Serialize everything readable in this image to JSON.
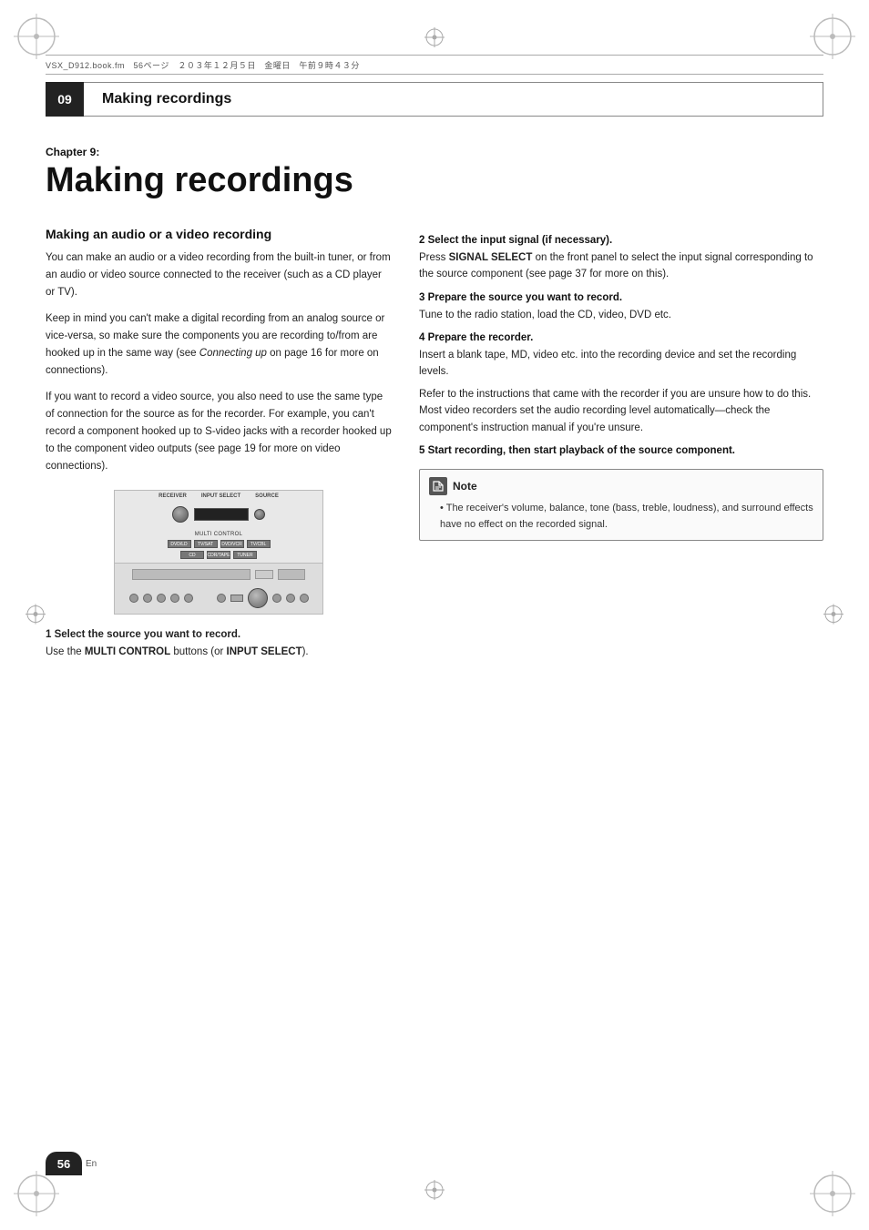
{
  "header": {
    "file_info": "VSX_D912.book.fm　56ページ　２０３年１２月５日　金曜日　午前９時４３分",
    "chapter_num": "09",
    "chapter_title": "Making recordings"
  },
  "chapter": {
    "label": "Chapter 9:",
    "title": "Making recordings"
  },
  "section": {
    "heading": "Making an audio or a video recording",
    "para1": "You can make an audio or a video recording from the built-in tuner, or from an audio or video source connected to the receiver (such as a CD player or TV).",
    "para2": "Keep in mind you can't make a digital recording from an analog source or vice-versa, so make sure the components you are recording to/from are hooked up in the same way (see Connecting up on page 16 for more on connections).",
    "para3": "If you want to record a video source, you also need to use the same type of connection for the source as for the recorder. For example, you can't record a component hooked up to S-video jacks with a recorder hooked up to the component video outputs (see page 19 for more on video connections)."
  },
  "steps": {
    "step1_heading": "1   Select the source you want to record.",
    "step1_text": "Use the MULTI CONTROL buttons (or INPUT SELECT).",
    "step2_heading": "2   Select the input signal (if necessary).",
    "step2_text": "Press SIGNAL SELECT on the front panel to select the input signal corresponding to the source component (see page 37 for more on this).",
    "step3_heading": "3   Prepare the source you want to record.",
    "step3_text": "Tune to the radio station, load the CD, video, DVD etc.",
    "step4_heading": "4   Prepare the recorder.",
    "step4_text1": "Insert a blank tape, MD, video etc. into the recording device and set the recording levels.",
    "step4_text2": "Refer to the instructions that came with the recorder if you are unsure how to do this. Most video recorders set the audio recording level automatically—check the component's instruction manual if you're unsure.",
    "step5_heading": "5   Start recording, then start playback of the source component.",
    "step2_signal_select": "SIGNAL SELECT",
    "step1_multi_control": "MULTI CONTROL",
    "step1_input_select": "INPUT SELECT"
  },
  "note": {
    "label": "Note",
    "bullet1": "The receiver's volume, balance, tone (bass, treble, loudness), and surround effects have no effect on the recorded signal."
  },
  "footer": {
    "page_num": "56",
    "lang": "En"
  },
  "device_buttons": {
    "btn1": "DVD/LD",
    "btn2": "TV/SAT",
    "btn3": "DVD/VCR",
    "btn4": "TV/CBL",
    "btn5": "CD",
    "btn6": "CDR/TAPE",
    "btn7": "TUNER",
    "btn8": "MULTI CONTROL"
  }
}
